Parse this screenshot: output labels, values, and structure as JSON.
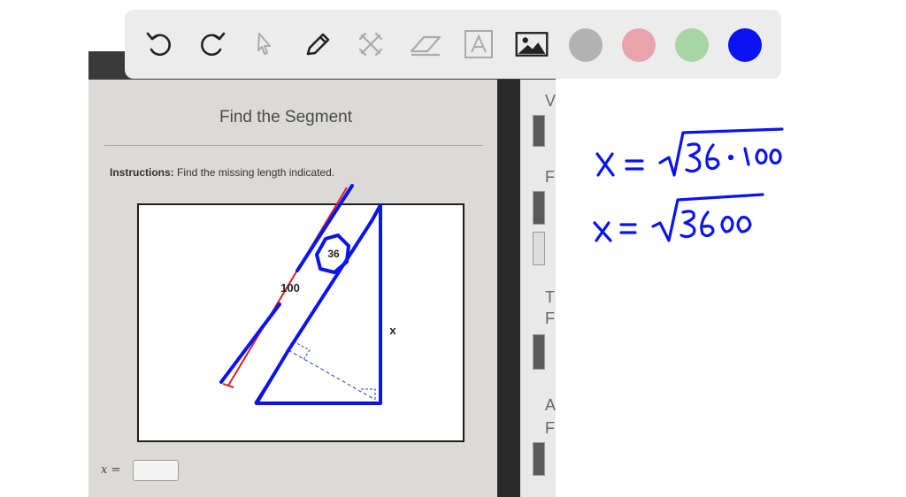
{
  "worksheet": {
    "title": "Find the Segment",
    "instructions_label": "Instructions:",
    "instructions_text": " Find the missing length indicated.",
    "answer_label": "x ="
  },
  "figure": {
    "label_long": "100",
    "label_short": "36",
    "label_unknown": "x"
  },
  "toolbar": {
    "tools": [
      "undo-icon",
      "redo-icon",
      "select-icon",
      "pen-icon",
      "tools-icon",
      "eraser-icon",
      "text-icon",
      "image-icon"
    ],
    "colors": [
      "#b3b3b3",
      "#e8a3ad",
      "#a8d5a3",
      "#0a14f0"
    ],
    "selected_color": "#0a14f0"
  },
  "handwriting": {
    "line1": "x = √36 · 100",
    "line2": "x = √3600"
  }
}
